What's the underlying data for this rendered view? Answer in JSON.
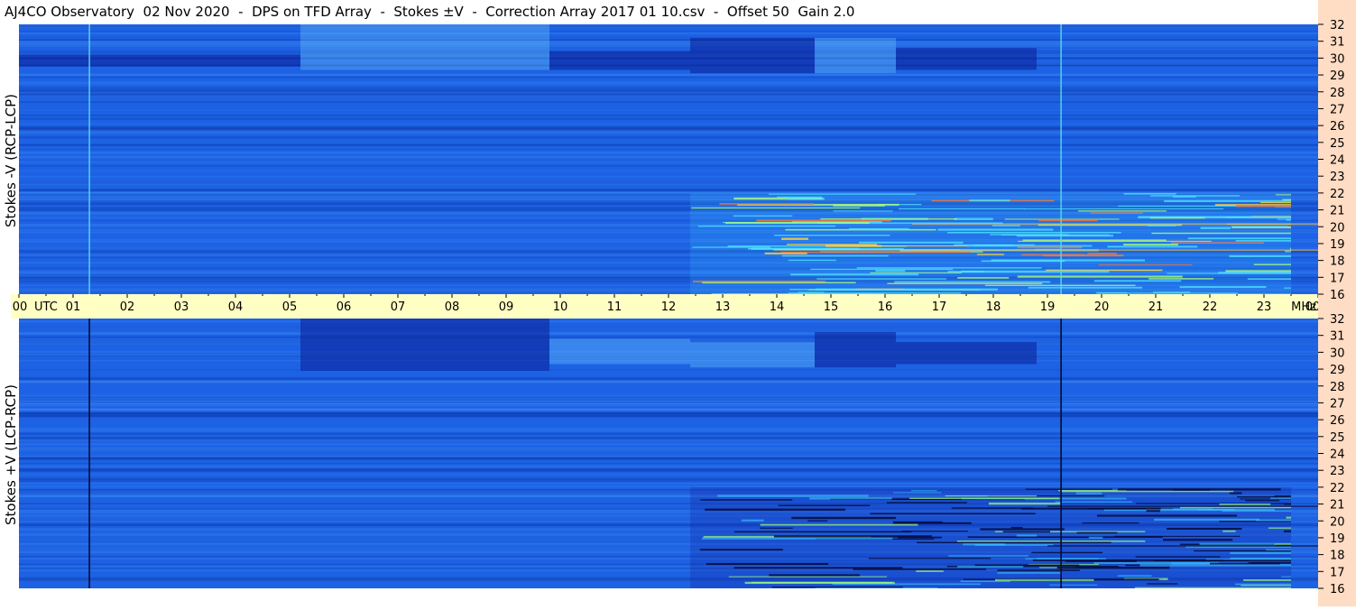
{
  "title": "AJ4CO Observatory  02 Nov 2020  -  DPS on TFD Array  -  Stokes ±V  -  Correction Array 2017 01 10.csv  -  Offset 50  Gain 2.0",
  "panels": {
    "top_label": "Stokes -V (RCP-LCP)",
    "bottom_label": "Stokes +V (LCP-RCP)"
  },
  "colors": {
    "spectrogram_base": "#1d62e4",
    "time_axis_bg": "#ffffc4",
    "freq_axis_bg": "#ffdcc4"
  },
  "chart_data": [
    {
      "type": "heatmap",
      "ylabel": "Stokes -V (RCP-LCP)",
      "x_axis": {
        "labels": [
          "00",
          "UTC",
          "01",
          "02",
          "03",
          "04",
          "05",
          "06",
          "07",
          "08",
          "09",
          "10",
          "11",
          "12",
          "13",
          "14",
          "15",
          "16",
          "17",
          "18",
          "19",
          "20",
          "21",
          "22",
          "23",
          "00",
          "MHz"
        ],
        "range_hours": [
          0,
          24
        ]
      },
      "y_axis": {
        "ticks": [
          "32",
          "31",
          "30",
          "29",
          "28",
          "27",
          "26",
          "25",
          "24",
          "23",
          "22",
          "21",
          "20",
          "19",
          "18",
          "17",
          "16"
        ],
        "range_mhz": [
          16,
          32
        ]
      },
      "regions": [
        {
          "x": [
            0,
            5.2
          ],
          "y": [
            29.5,
            30.2
          ],
          "shade": "dark"
        },
        {
          "x": [
            5.2,
            9.8
          ],
          "y": [
            29.3,
            32
          ],
          "shade": "light"
        },
        {
          "x": [
            9.8,
            12.4
          ],
          "y": [
            29.3,
            30.4
          ],
          "shade": "dark"
        },
        {
          "x": [
            12.4,
            14.7
          ],
          "y": [
            29.1,
            31.2
          ],
          "shade": "dark"
        },
        {
          "x": [
            14.7,
            16.2
          ],
          "y": [
            29.1,
            31.2
          ],
          "shade": "light"
        },
        {
          "x": [
            16.2,
            18.8
          ],
          "y": [
            29.3,
            30.6
          ],
          "shade": "dark"
        },
        {
          "x": [
            12.4,
            23.5
          ],
          "y": [
            16,
            22
          ],
          "shade": "bright"
        }
      ],
      "vertical_lines_hours": [
        1.3,
        19.25
      ]
    },
    {
      "type": "heatmap",
      "ylabel": "Stokes +V (LCP-RCP)",
      "x_axis": {
        "range_hours": [
          0,
          24
        ]
      },
      "y_axis": {
        "ticks": [
          "32",
          "31",
          "30",
          "29",
          "28",
          "27",
          "26",
          "25",
          "24",
          "23",
          "22",
          "21",
          "20",
          "19",
          "18",
          "17",
          "16"
        ],
        "range_mhz": [
          16,
          32
        ]
      },
      "regions": [
        {
          "x": [
            5.2,
            9.8
          ],
          "y": [
            28.9,
            32
          ],
          "shade": "dark"
        },
        {
          "x": [
            9.8,
            12.4
          ],
          "y": [
            29.3,
            30.8
          ],
          "shade": "light"
        },
        {
          "x": [
            12.4,
            14.7
          ],
          "y": [
            29.1,
            30.6
          ],
          "shade": "light"
        },
        {
          "x": [
            14.7,
            16.2
          ],
          "y": [
            29.1,
            31.2
          ],
          "shade": "dark"
        },
        {
          "x": [
            16.2,
            18.8
          ],
          "y": [
            29.3,
            30.6
          ],
          "shade": "dark"
        },
        {
          "x": [
            12.4,
            23.5
          ],
          "y": [
            16,
            22
          ],
          "shade": "dark_dropouts"
        }
      ],
      "vertical_lines_hours": [
        1.3,
        19.25
      ]
    }
  ]
}
